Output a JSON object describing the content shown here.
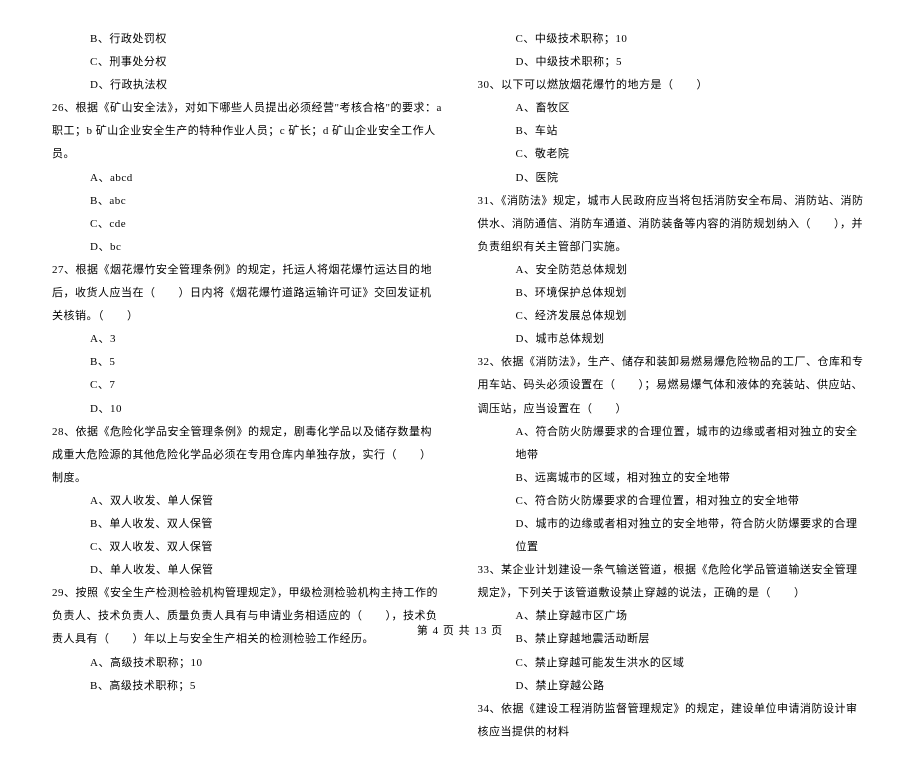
{
  "left": {
    "opts25": [
      "B、行政处罚权",
      "C、刑事处分权",
      "D、行政执法权"
    ],
    "q26": "26、根据《矿山安全法》，对如下哪些人员提出必须经营\"考核合格\"的要求：a 职工；b 矿山企业安全生产的特种作业人员；c 矿长；d 矿山企业安全工作人员。",
    "opts26": [
      "A、abcd",
      "B、abc",
      "C、cde",
      "D、bc"
    ],
    "q27": "27、根据《烟花爆竹安全管理条例》的规定，托运人将烟花爆竹运达目的地后，收货人应当在（　　）日内将《烟花爆竹道路运输许可证》交回发证机关核销。（　　）",
    "opts27": [
      "A、3",
      "B、5",
      "C、7",
      "D、10"
    ],
    "q28": "28、依据《危险化学品安全管理条例》的规定，剧毒化学品以及储存数量构成重大危险源的其他危险化学品必须在专用仓库内单独存放，实行（　　）制度。",
    "opts28": [
      "A、双人收发、单人保管",
      "B、单人收发、双人保管",
      "C、双人收发、双人保管",
      "D、单人收发、单人保管"
    ],
    "q29": "29、按照《安全生产检测检验机构管理规定》，甲级检测检验机构主持工作的负责人、技术负责人、质量负责人具有与申请业务相适应的（　　），技术负责人具有（　　）年以上与安全生产相关的检测检验工作经历。",
    "opts29": [
      "A、高级技术职称；10",
      "B、高级技术职称；5"
    ]
  },
  "right": {
    "opts29b": [
      "C、中级技术职称；10",
      "D、中级技术职称；5"
    ],
    "q30": "30、以下可以燃放烟花爆竹的地方是（　　）",
    "opts30": [
      "A、畜牧区",
      "B、车站",
      "C、敬老院",
      "D、医院"
    ],
    "q31": "31、《消防法》规定，城市人民政府应当将包括消防安全布局、消防站、消防供水、消防通信、消防车通道、消防装备等内容的消防规划纳入（　　），并负责组织有关主管部门实施。",
    "opts31": [
      "A、安全防范总体规划",
      "B、环境保护总体规划",
      "C、经济发展总体规划",
      "D、城市总体规划"
    ],
    "q32": "32、依据《消防法》，生产、储存和装卸易燃易爆危险物品的工厂、仓库和专用车站、码头必须设置在（　　）；易燃易爆气体和液体的充装站、供应站、调压站，应当设置在（　　）",
    "opts32": [
      "A、符合防火防爆要求的合理位置，城市的边缘或者相对独立的安全地带",
      "B、远离城市的区域，相对独立的安全地带",
      "C、符合防火防爆要求的合理位置，相对独立的安全地带",
      "D、城市的边缘或者相对独立的安全地带，符合防火防爆要求的合理位置"
    ],
    "q33": "33、某企业计划建设一条气输送管道，根据《危险化学品管道输送安全管理规定》，下列关于该管道敷设禁止穿越的说法，正确的是（　　）",
    "opts33": [
      "A、禁止穿越市区广场",
      "B、禁止穿越地震活动断层",
      "C、禁止穿越可能发生洪水的区域",
      "D、禁止穿越公路"
    ],
    "q34": "34、依据《建设工程消防监督管理规定》的规定，建设单位申请消防设计审核应当提供的材料"
  },
  "footer": "第 4 页 共 13 页"
}
